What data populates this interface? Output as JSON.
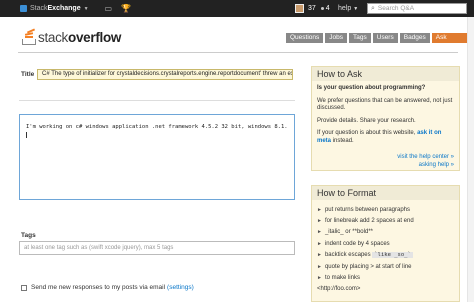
{
  "topbar": {
    "brand_light": "Stack",
    "brand_bold": "Exchange",
    "reputation": "37",
    "badge_count": "4",
    "help_label": "help",
    "search_placeholder": "Search Q&A"
  },
  "logo": {
    "light": "stack",
    "bold": "overflow"
  },
  "nav": [
    {
      "label": "Questions"
    },
    {
      "label": "Jobs"
    },
    {
      "label": "Tags"
    },
    {
      "label": "Users"
    },
    {
      "label": "Badges"
    },
    {
      "label": "Ask Question"
    }
  ],
  "form": {
    "title_label": "Title",
    "title_value": "C# The type of initializer for crystaldecisions.crystalreports.engine.reportdocument' threw an ex",
    "body_text": "I'm working on c# windows application .net framework 4.5.2 32 bit, windows 8.1.",
    "tags_label": "Tags",
    "tags_placeholder": "at least one tag such as (swift xcode jquery), max 5 tags",
    "notify_label": "Send me new responses to my posts via email",
    "notify_link": "(settings)"
  },
  "how_to_ask": {
    "title": "How to Ask",
    "question": "Is your question about programming?",
    "p1": "We prefer questions that can be answered, not just discussed.",
    "p2": "Provide details. Share your research.",
    "p3_prefix": "If your question is about this website,",
    "p3_link": "ask it on meta",
    "p3_suffix": "instead.",
    "link1": "visit the help center »",
    "link2": "asking help »"
  },
  "how_to_format": {
    "title": "How to Format",
    "items": [
      "put returns between paragraphs",
      "for linebreak add 2 spaces at end",
      "_italic_ or **bold**",
      "indent code by 4 spaces",
      "backtick escapes",
      "quote by placing > at start of line",
      "to make links"
    ],
    "backtick_code": "`like _so_`",
    "last_line": "<http://foo.com>"
  }
}
